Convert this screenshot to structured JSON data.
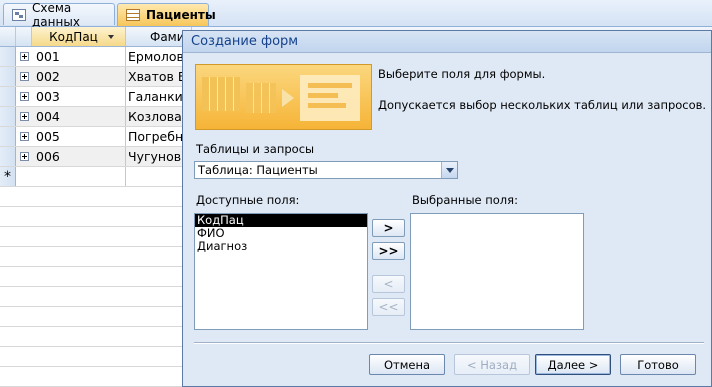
{
  "tabs": [
    {
      "label": "Схема данных",
      "icon": "relationships-icon"
    },
    {
      "label": "Пациенты",
      "icon": "table-icon"
    }
  ],
  "datasheet": {
    "columns": [
      "КодПац",
      "Фами"
    ],
    "rows": [
      {
        "kod": "001",
        "fio": "Ермолов"
      },
      {
        "kod": "002",
        "fio": "Хватов В"
      },
      {
        "kod": "003",
        "fio": "Галанкин"
      },
      {
        "kod": "004",
        "fio": "Козлова"
      },
      {
        "kod": "005",
        "fio": "Погребн"
      },
      {
        "kod": "006",
        "fio": "Чугунов"
      }
    ],
    "new_row_marker": "*"
  },
  "wizard": {
    "title": "Создание форм",
    "prompt": "Выберите поля для формы.",
    "hint": "Допускается выбор нескольких таблиц или запросов.",
    "tables_label": "Таблицы и запросы",
    "tables_value": "Таблица: Пациенты",
    "available_label": "Доступные поля:",
    "selected_label": "Выбранные поля:",
    "available_fields": [
      "КодПац",
      "ФИО",
      "Диагноз"
    ],
    "selected_field_index": 0,
    "selected_fields": [],
    "move_buttons": {
      "one": ">",
      "all": ">>",
      "back_one": "<",
      "back_all": "<<"
    },
    "buttons": {
      "cancel": "Отмена",
      "back": "< Назад",
      "next": "Далее >",
      "finish": "Готово"
    }
  }
}
